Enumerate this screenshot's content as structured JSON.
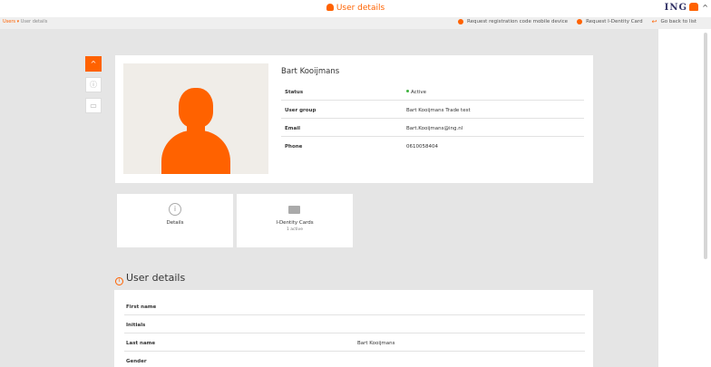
{
  "header": {
    "title": "User details",
    "logo": "ING",
    "brand_color": "#ff6200"
  },
  "breadcrumb": {
    "root": "Users",
    "separator": "▾",
    "current": "User details"
  },
  "actions": [
    {
      "label": "Request registration code mobile device",
      "icon": "plus-circle-icon"
    },
    {
      "label": "Request I-Dentity Card",
      "icon": "plus-circle-icon"
    },
    {
      "label": "Go back to list",
      "icon": "return-arrow-icon"
    }
  ],
  "profile": {
    "name": "Bart Kooijmans",
    "rows": [
      {
        "key": "Status",
        "value": "Active",
        "status_color": "#3fb33f"
      },
      {
        "key": "User group",
        "value": "Bart Kooijmans Trade test"
      },
      {
        "key": "Email",
        "value": "Bart.Kooijmans@ing.nl"
      },
      {
        "key": "Phone",
        "value": "0610058404"
      }
    ]
  },
  "tiles": [
    {
      "label": "Details",
      "sub": "",
      "icon": "info-icon"
    },
    {
      "label": "I-Dentity Cards",
      "sub": "1 active",
      "icon": "id-card-icon"
    }
  ],
  "section": {
    "title": "User details",
    "icon": "info-icon"
  },
  "details": [
    {
      "key": "First name",
      "value": ""
    },
    {
      "key": "Initials",
      "value": ""
    },
    {
      "key": "Last name",
      "value": "Bart Kooijmans"
    },
    {
      "key": "Gender",
      "value": ""
    }
  ]
}
